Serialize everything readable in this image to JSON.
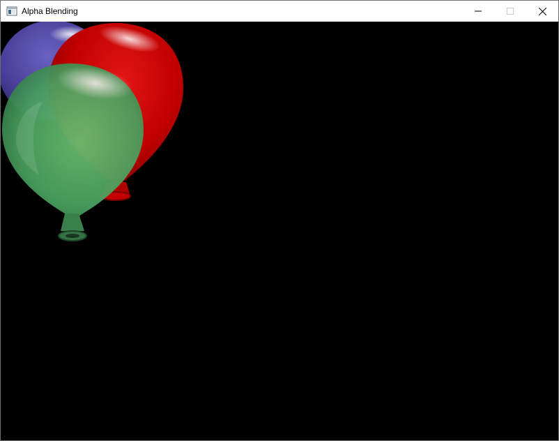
{
  "window": {
    "title": "Alpha Blending",
    "icon": "app-window-icon",
    "controls": {
      "minimize_icon": "minimize-icon",
      "maximize_icon": "maximize-icon",
      "close_icon": "close-icon"
    }
  },
  "client": {
    "background": "#000000",
    "balloons": [
      {
        "name": "blue-balloon",
        "color": "#4a3f9a"
      },
      {
        "name": "red-balloon",
        "color": "#c00000"
      },
      {
        "name": "green-balloon",
        "color": "#4aa160"
      }
    ]
  }
}
